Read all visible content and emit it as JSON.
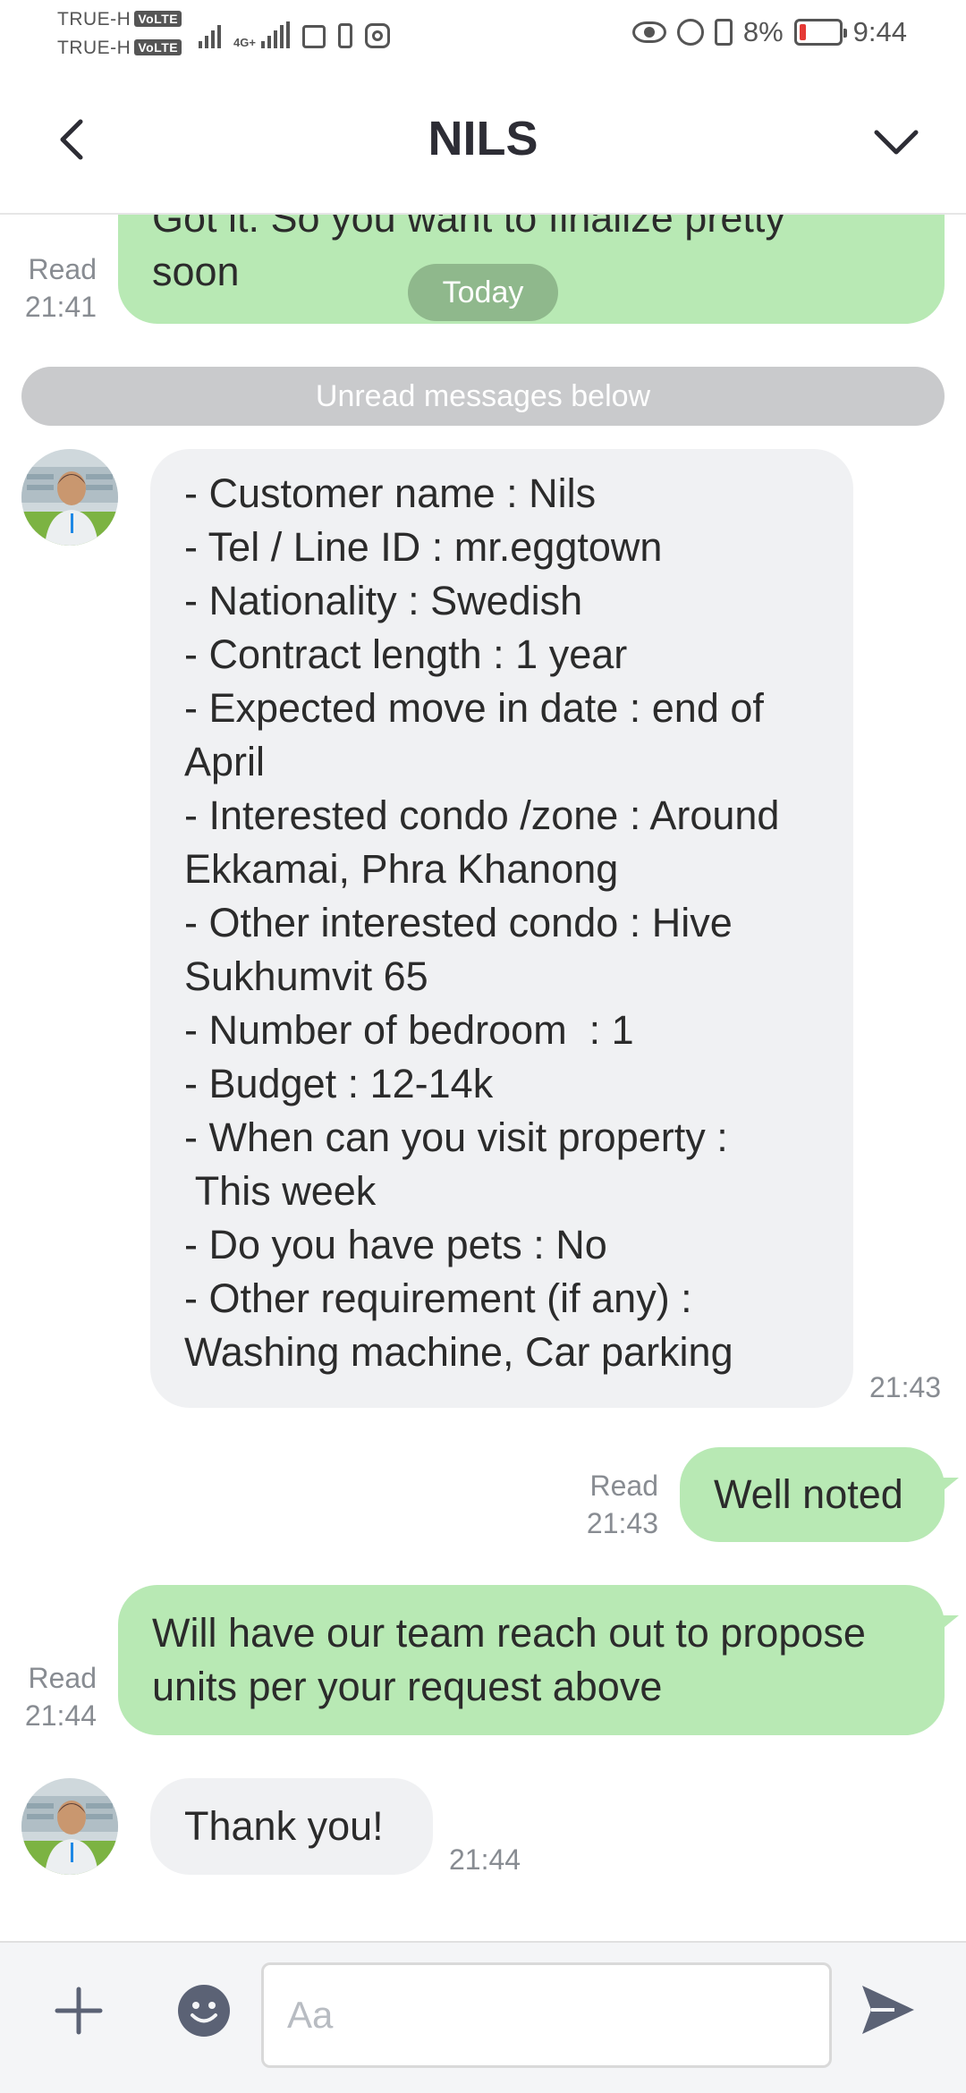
{
  "status_bar": {
    "carrier_1": "TRUE-H",
    "carrier_2": "TRUE-H",
    "volte": "VoLTE",
    "network": "4G+",
    "battery": "8%",
    "time": "9:44",
    "icons": [
      "signal-icon",
      "network-signal-icon",
      "sim-icon",
      "phone-icon",
      "instagram-icon",
      "eye-icon",
      "alarm-icon",
      "vibrate-icon",
      "battery-icon"
    ]
  },
  "header": {
    "title": "NILS",
    "back_icon": "chevron-left-icon",
    "menu_icon": "chevron-down-icon"
  },
  "chat": {
    "date_separator": "Today",
    "unread_banner": "Unread messages below",
    "messages": [
      {
        "direction": "out",
        "lines": [
          "Got it. So you want to finalize pretty",
          "soon"
        ],
        "status": "Read",
        "time": "21:41"
      },
      {
        "direction": "in",
        "lines": [
          "- Customer name : Nils",
          "- Tel / Line ID : mr.eggtown",
          "- Nationality : Swedish",
          "- Contract length : 1 year",
          "- Expected move in date : end of",
          "April",
          "- Interested condo /zone : Around",
          "Ekkamai, Phra Khanong",
          "- Other interested condo : Hive",
          "Sukhumvit 65",
          "- Number of bedroom  : 1",
          "- Budget : 12-14k",
          "- When can you visit property :",
          " This week",
          "- Do you have pets : No",
          "- Other requirement (if any) :",
          "Washing machine, Car parking"
        ],
        "time": "21:43"
      },
      {
        "direction": "out",
        "lines": [
          "Well noted"
        ],
        "status": "Read",
        "time": "21:43"
      },
      {
        "direction": "out",
        "lines": [
          "Will have our team reach out to propose",
          "units per your request above"
        ],
        "status": "Read",
        "time": "21:44"
      },
      {
        "direction": "in",
        "lines": [
          "Thank you!"
        ],
        "time": "21:44"
      }
    ]
  },
  "input_bar": {
    "placeholder": "Aa",
    "value": "",
    "icons": [
      "plus-icon",
      "emoji-icon",
      "send-icon"
    ]
  },
  "colors": {
    "outgoing_bubble": "#b8e9b4",
    "incoming_bubble": "#f0f1f3",
    "unread_banner": "#c9cacc",
    "today_pill": "#8fb88c",
    "icon_gray": "#5b6275"
  }
}
